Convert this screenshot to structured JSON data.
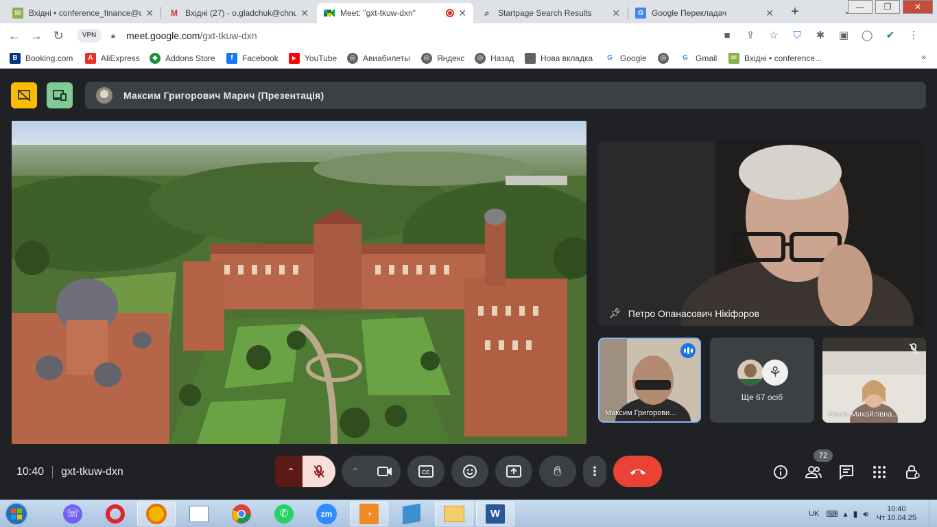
{
  "browser": {
    "tabs": [
      {
        "title": "Вхідні • conference_finance@u",
        "icon": "inbox-mail-icon"
      },
      {
        "title": "Вхідні (27) - o.gladchuk@chnu",
        "icon": "gmail-icon"
      },
      {
        "title": "Meet: \"gxt-tkuw-dxn\"",
        "icon": "google-meet-icon",
        "active": true
      },
      {
        "title": "Startpage Search Results",
        "icon": "search-icon"
      },
      {
        "title": "Google Перекладач",
        "icon": "google-translate-icon"
      }
    ],
    "url": {
      "host": "meet.google.com",
      "path": "/gxt-tkuw-dxn"
    },
    "vpn_label": "VPN",
    "bookmarks": [
      {
        "label": "Booking.com",
        "color": "#003580",
        "glyph": "B"
      },
      {
        "label": "AliExpress",
        "color": "#e43225",
        "glyph": "A"
      },
      {
        "label": "Addons Store",
        "color": "#1a8c3a",
        "glyph": "◆"
      },
      {
        "label": "Facebook",
        "color": "#1877f2",
        "glyph": "f"
      },
      {
        "label": "YouTube",
        "color": "#ff0000",
        "glyph": "▶"
      },
      {
        "label": "Авиабилеты",
        "color": "#5f6368",
        "glyph": "◎"
      },
      {
        "label": "Яндекс",
        "color": "#5f6368",
        "glyph": "◎"
      },
      {
        "label": "Назад",
        "color": "#5f6368",
        "glyph": "◎"
      },
      {
        "label": "Нова вкладка",
        "color": "#5f6368",
        "glyph": "■"
      },
      {
        "label": "Google",
        "color": "#4285f4",
        "glyph": "G"
      },
      {
        "label": "",
        "color": "#5f6368",
        "glyph": "◎"
      },
      {
        "label": "Gmail",
        "color": "#4285f4",
        "glyph": "G"
      },
      {
        "label": "Вхідні • conference...",
        "color": "#8ab04a",
        "glyph": "✉"
      }
    ],
    "bookmarks_more": "»"
  },
  "meet": {
    "presenter_bar": "Максим Григорович Марич (Презентація)",
    "main_speaker": "Петро Опанасович Нікіфоров",
    "tiles": [
      {
        "name": "Максим Григорови..."
      },
      {
        "name": "Ще 67 осіб"
      },
      {
        "name": "Ольга Михайлівна..."
      }
    ],
    "time": "10:40",
    "meeting_code": "gxt-tkuw-dxn",
    "participants_count": "72"
  },
  "taskbar": {
    "lang": "UK",
    "clock_time": "10:40",
    "clock_date": "Чт 10.04.25"
  },
  "colors": {
    "end_call": "#ea4335",
    "mic_off_bg": "#f9dedc",
    "mic_off_fg": "#8c1d18",
    "presentation_yellow": "#fbbc04",
    "pip_green": "#81c995"
  }
}
